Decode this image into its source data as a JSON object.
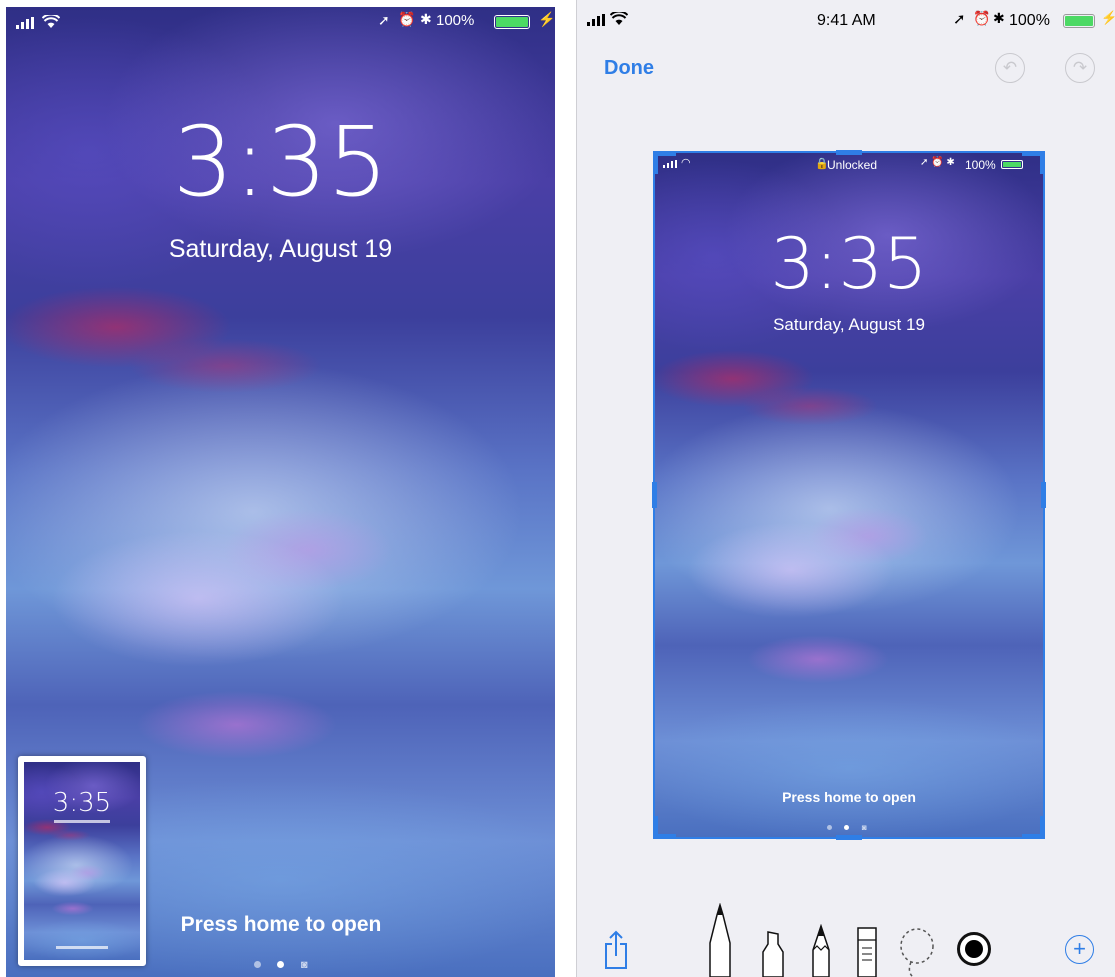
{
  "left_phone": {
    "status": {
      "carrier_signal": "signal-bars",
      "wifi": "wifi-icon",
      "battery_pct": "100%",
      "location": "location-arrow-icon",
      "alarm": "alarm-icon",
      "bluetooth": "bluetooth-icon",
      "charging": "bolt-icon"
    },
    "time": "3:35",
    "date": "Saturday, August 19",
    "press_home": "Press home to open",
    "thumbnail": {
      "time": "3:35"
    }
  },
  "right_panel": {
    "status": {
      "time": "9:41 AM",
      "battery_pct": "100%"
    },
    "toolbar": {
      "done_label": "Done",
      "undo_icon": "undo-icon",
      "redo_icon": "redo-icon"
    },
    "screenshot": {
      "unlocked_label": "Unlocked",
      "battery_pct": "100%",
      "time": "3:35",
      "date": "Saturday, August 19",
      "press_home": "Press home to open"
    },
    "tools": [
      "share-icon",
      "pen-tool-icon",
      "marker-tool-icon",
      "pencil-tool-icon",
      "eraser-tool-icon",
      "lasso-tool-icon",
      "color-picker-icon",
      "add-icon"
    ]
  },
  "colors": {
    "accent": "#2f7ee6",
    "battery": "#4cd964",
    "panel_bg": "#efeff4"
  }
}
